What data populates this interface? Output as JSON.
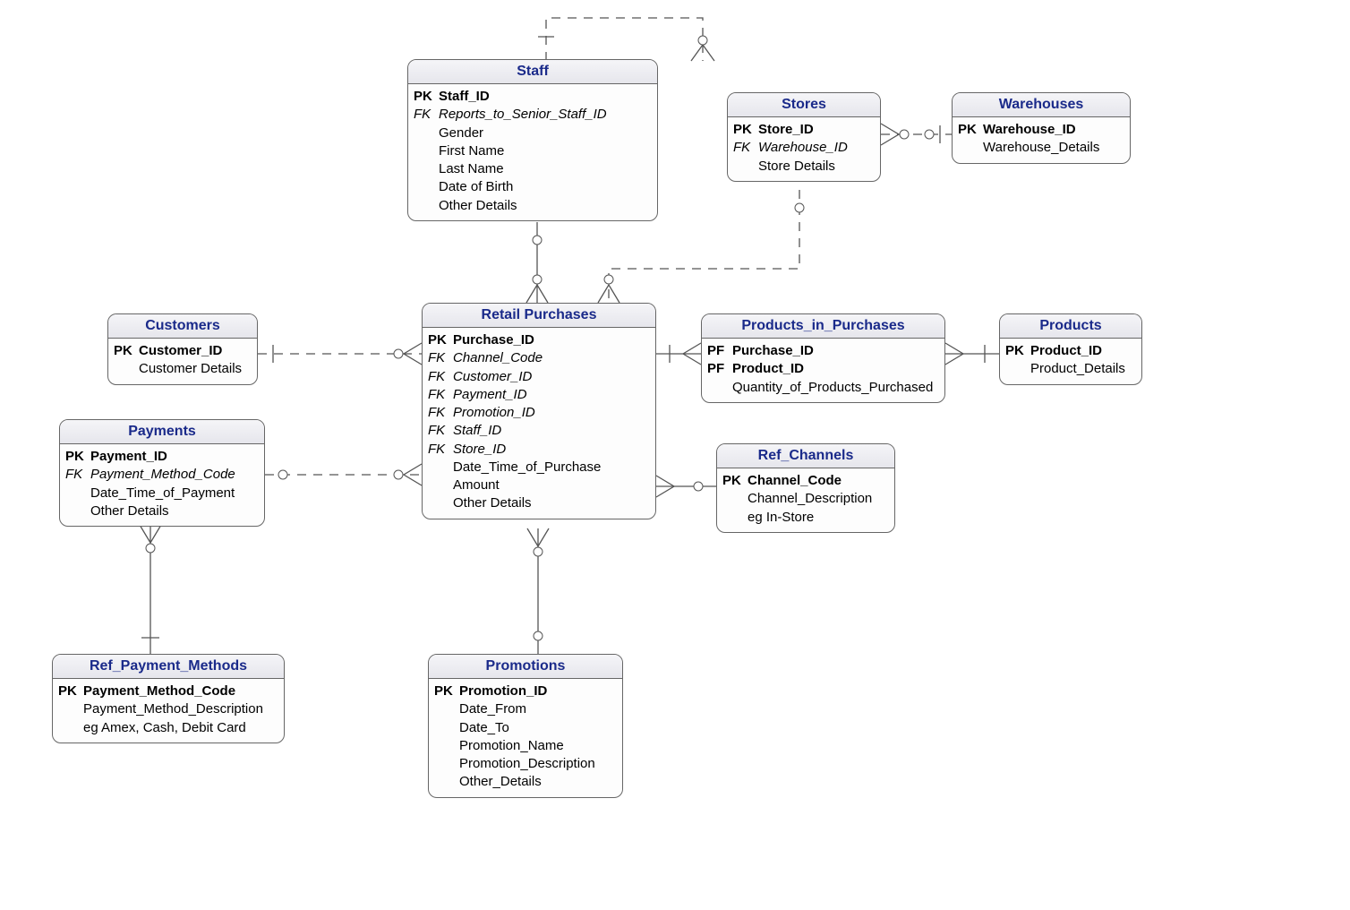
{
  "entities": {
    "staff": {
      "title": "Staff",
      "attrs": [
        {
          "key": "PK",
          "name": "Staff_ID",
          "pk": true
        },
        {
          "key": "FK",
          "name": "Reports_to_Senior_Staff_ID",
          "fk": true
        },
        {
          "key": "",
          "name": "Gender"
        },
        {
          "key": "",
          "name": "First Name"
        },
        {
          "key": "",
          "name": "Last Name"
        },
        {
          "key": "",
          "name": "Date of Birth"
        },
        {
          "key": "",
          "name": "Other Details"
        }
      ]
    },
    "stores": {
      "title": "Stores",
      "attrs": [
        {
          "key": "PK",
          "name": "Store_ID",
          "pk": true
        },
        {
          "key": "FK",
          "name": "Warehouse_ID",
          "fk": true
        },
        {
          "key": "",
          "name": "Store Details"
        }
      ]
    },
    "warehouses": {
      "title": "Warehouses",
      "attrs": [
        {
          "key": "PK",
          "name": "Warehouse_ID",
          "pk": true
        },
        {
          "key": "",
          "name": "Warehouse_Details"
        }
      ]
    },
    "customers": {
      "title": "Customers",
      "attrs": [
        {
          "key": "PK",
          "name": "Customer_ID",
          "pk": true
        },
        {
          "key": "",
          "name": "Customer Details"
        }
      ]
    },
    "retail_purchases": {
      "title": "Retail Purchases",
      "attrs": [
        {
          "key": "PK",
          "name": "Purchase_ID",
          "pk": true
        },
        {
          "key": "FK",
          "name": "Channel_Code",
          "fk": true
        },
        {
          "key": "FK",
          "name": "Customer_ID",
          "fk": true
        },
        {
          "key": "FK",
          "name": "Payment_ID",
          "fk": true
        },
        {
          "key": "FK",
          "name": "Promotion_ID",
          "fk": true
        },
        {
          "key": "FK",
          "name": "Staff_ID",
          "fk": true
        },
        {
          "key": "FK",
          "name": "Store_ID",
          "fk": true
        },
        {
          "key": "",
          "name": "Date_Time_of_Purchase"
        },
        {
          "key": "",
          "name": "Amount"
        },
        {
          "key": "",
          "name": "Other Details"
        }
      ]
    },
    "products_in_purchases": {
      "title": "Products_in_Purchases",
      "attrs": [
        {
          "key": "PF",
          "name": "Purchase_ID",
          "pk": true
        },
        {
          "key": "PF",
          "name": "Product_ID",
          "pk": true
        },
        {
          "key": "",
          "name": "Quantity_of_Products_Purchased"
        }
      ]
    },
    "products": {
      "title": "Products",
      "attrs": [
        {
          "key": "PK",
          "name": "Product_ID",
          "pk": true
        },
        {
          "key": "",
          "name": "Product_Details"
        }
      ]
    },
    "payments": {
      "title": "Payments",
      "attrs": [
        {
          "key": "PK",
          "name": "Payment_ID",
          "pk": true
        },
        {
          "key": "FK",
          "name": "Payment_Method_Code",
          "fk": true
        },
        {
          "key": "",
          "name": "Date_Time_of_Payment"
        },
        {
          "key": "",
          "name": "Other Details"
        }
      ]
    },
    "ref_channels": {
      "title": "Ref_Channels",
      "attrs": [
        {
          "key": "PK",
          "name": "Channel_Code",
          "pk": true
        },
        {
          "key": "",
          "name": "Channel_Description"
        },
        {
          "key": "",
          "name": "eg In-Store"
        }
      ]
    },
    "ref_payment_methods": {
      "title": "Ref_Payment_Methods",
      "attrs": [
        {
          "key": "PK",
          "name": "Payment_Method_Code",
          "pk": true
        },
        {
          "key": "",
          "name": "Payment_Method_Description"
        },
        {
          "key": "",
          "name": "eg Amex, Cash, Debit Card"
        }
      ]
    },
    "promotions": {
      "title": "Promotions",
      "attrs": [
        {
          "key": "PK",
          "name": "Promotion_ID",
          "pk": true
        },
        {
          "key": "",
          "name": "Date_From"
        },
        {
          "key": "",
          "name": "Date_To"
        },
        {
          "key": "",
          "name": "Promotion_Name"
        },
        {
          "key": "",
          "name": "Promotion_Description"
        },
        {
          "key": "",
          "name": "Other_Details"
        }
      ]
    }
  },
  "relationships": [
    {
      "from": "staff",
      "to": "staff",
      "type": "self-reference one-to-many optional"
    },
    {
      "from": "stores",
      "to": "warehouses",
      "type": "many-to-one optional"
    },
    {
      "from": "retail_purchases",
      "to": "staff",
      "type": "many-to-one optional"
    },
    {
      "from": "retail_purchases",
      "to": "stores",
      "type": "many-to-one optional"
    },
    {
      "from": "retail_purchases",
      "to": "customers",
      "type": "many-to-one optional/mandatory"
    },
    {
      "from": "retail_purchases",
      "to": "payments",
      "type": "many-to-one optional"
    },
    {
      "from": "retail_purchases",
      "to": "ref_channels",
      "type": "many-to-one optional"
    },
    {
      "from": "retail_purchases",
      "to": "promotions",
      "type": "many-to-one optional"
    },
    {
      "from": "products_in_purchases",
      "to": "retail_purchases",
      "type": "many-to-one mandatory"
    },
    {
      "from": "products_in_purchases",
      "to": "products",
      "type": "many-to-one mandatory"
    },
    {
      "from": "payments",
      "to": "ref_payment_methods",
      "type": "many-to-one mandatory"
    }
  ]
}
